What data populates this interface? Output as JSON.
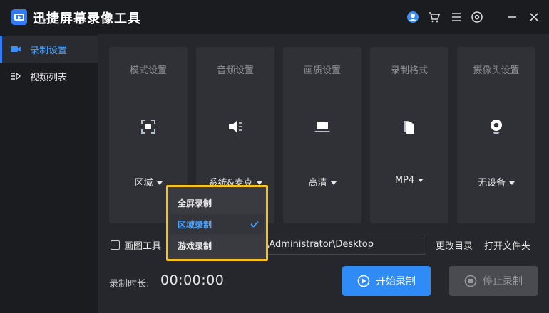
{
  "app": {
    "title": "迅捷屏幕录像工具",
    "accent_color": "#2f7cf6",
    "highlight_color": "#f7c21c"
  },
  "titlebar": {
    "icons": [
      "user-icon",
      "cart-icon",
      "menu-icon",
      "settings-icon",
      "minimize-icon",
      "close-icon"
    ]
  },
  "sidebar": {
    "items": [
      {
        "label": "录制设置",
        "icon": "video-camera-icon",
        "active": true
      },
      {
        "label": "视频列表",
        "icon": "list-icon",
        "active": false
      }
    ]
  },
  "settings_cards": [
    {
      "title": "模式设置",
      "value": "区域",
      "icon": "region-icon"
    },
    {
      "title": "音频设置",
      "value": "系统&麦克",
      "icon": "speaker-icon"
    },
    {
      "title": "画质设置",
      "value": "高清",
      "icon": "laptop-icon"
    },
    {
      "title": "录制格式",
      "value": "MP4",
      "icon": "file-icon"
    },
    {
      "title": "摄像头设置",
      "value": "无设备",
      "icon": "webcam-icon"
    }
  ],
  "mode_dropdown": {
    "options": [
      {
        "label": "全屏录制",
        "selected": false
      },
      {
        "label": "区域录制",
        "selected": true
      },
      {
        "label": "游戏录制",
        "selected": false
      }
    ]
  },
  "output": {
    "draw_tool_label": "画图工具",
    "path_value": "\\Administrator\\Desktop",
    "change_dir_label": "更改目录",
    "open_folder_label": "打开文件夹"
  },
  "recording": {
    "duration_label": "录制时长:",
    "duration_value": "00:00:00",
    "start_label": "开始录制",
    "stop_label": "停止录制"
  }
}
